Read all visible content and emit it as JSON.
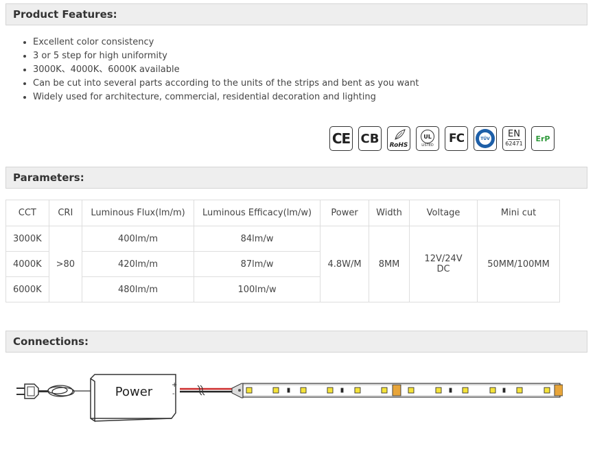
{
  "product_features": {
    "title": "Product Features:",
    "items": [
      "Excellent color consistency",
      "3 or 5 step for high uniformity",
      "3000K、4000K、6000K available",
      "Can be cut into several parts according to the units of the strips and bent as you want",
      "Widely used for architecture, commercial, residential decoration and lighting"
    ]
  },
  "certifications": {
    "ce": "CE",
    "cb": "CB",
    "rohs": "RoHS",
    "ul": "UL",
    "ul_listed": "LISTED",
    "fc": "FC",
    "tuv": "TÜV",
    "en_top": "EN",
    "en_bottom": "62471",
    "erp": "ErP"
  },
  "parameters": {
    "title": "Parameters:",
    "headers": [
      "CCT",
      "CRI",
      "Luminous Flux(lm/m)",
      "Luminous Efficacy(lm/w)",
      "Power",
      "Width",
      "Voltage",
      "Mini cut"
    ],
    "rows": [
      {
        "cct": "3000K",
        "flux": "400lm/m",
        "efficacy": "84lm/w"
      },
      {
        "cct": "4000K",
        "flux": "420lm/m",
        "efficacy": "87lm/w"
      },
      {
        "cct": "6000K",
        "flux": "480lm/m",
        "efficacy": "100lm/w"
      }
    ],
    "shared": {
      "cri": ">80",
      "power": "4.8W/M",
      "width": "8MM",
      "voltage": "12V/24V DC",
      "mini_cut": "50MM/100MM"
    }
  },
  "connections": {
    "title": "Connections:",
    "power_label": "Power",
    "plus": "+",
    "minus": "-",
    "colors": {
      "led": "#f5e33a",
      "pad": "#e8a53a",
      "red_wire": "#cc2a2a"
    }
  }
}
